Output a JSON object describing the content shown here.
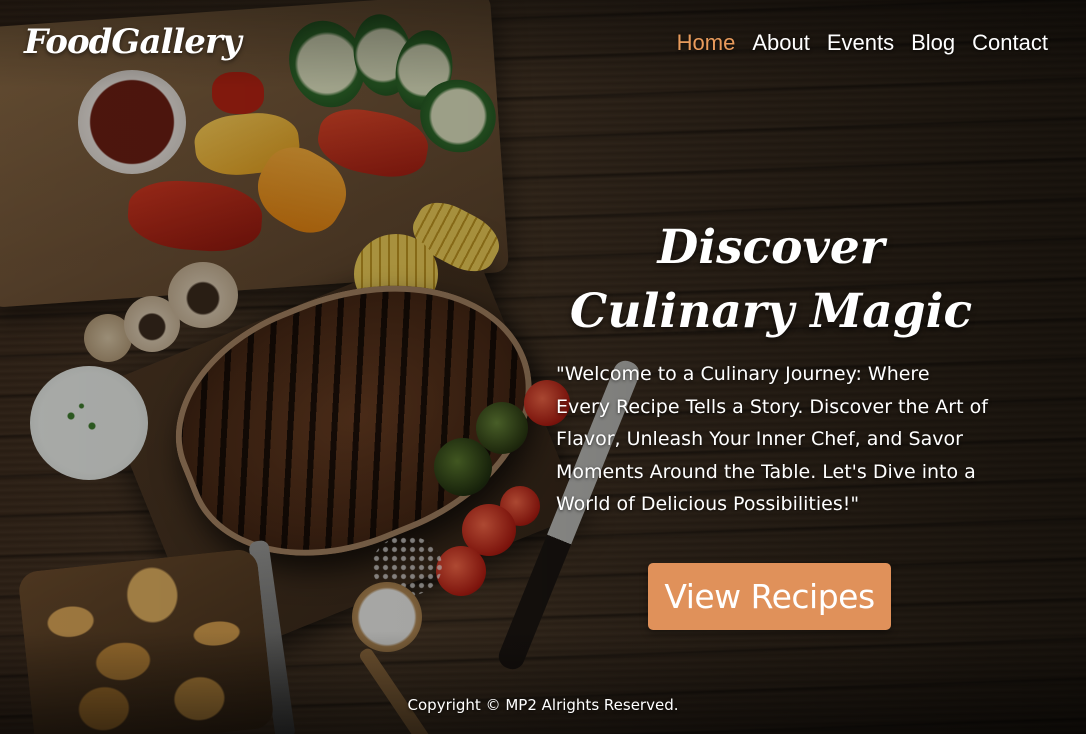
{
  "brand": {
    "logo_text": "FoodGallery"
  },
  "nav": {
    "items": [
      {
        "label": "Home",
        "active": true
      },
      {
        "label": "About",
        "active": false
      },
      {
        "label": "Events",
        "active": false
      },
      {
        "label": "Blog",
        "active": false
      },
      {
        "label": "Contact",
        "active": false
      }
    ]
  },
  "hero": {
    "title": "Discover Culinary Magic",
    "text": "\"Welcome to a Culinary Journey: Where Every Recipe Tells a Story. Discover the Art of Flavor, Unleash Your Inner Chef, and Savor Moments Around the Table. Let's Dive into a World of Delicious Possibilities!\"",
    "cta_label": "View Recipes"
  },
  "footer": {
    "copyright": "Copyright © MP2 Alrights Reserved."
  },
  "colors": {
    "accent": "#e89b5c",
    "button": "#e0915a",
    "text": "#ffffff"
  }
}
